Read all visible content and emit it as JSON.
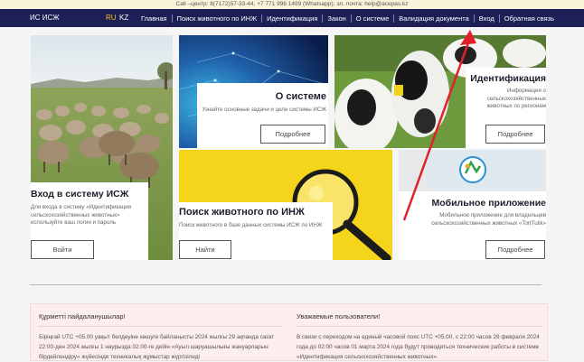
{
  "topbar": {
    "text": "Call –центр: 8(7172)57-33-44, +7 771 996 1499 (Whatsapp), эл. почта: help@acepas.kz"
  },
  "nav": {
    "brand": "ИС ИСЖ",
    "lang_ru": "RU",
    "lang_kz": "KZ",
    "items": [
      "Главная",
      "Поиск животного по ИНЖ",
      "Идентификация",
      "Закон",
      "О системе",
      "Валидация документа",
      "Вход",
      "Обратная связь"
    ]
  },
  "cards": {
    "login": {
      "title": "Вход в систему ИСЖ",
      "desc": "Для входа в систему «Идентификация сельскохозяйственных животных» используйте ваш логин и пароль",
      "button": "Войти"
    },
    "about": {
      "title": "О системе",
      "desc": "Узнайте основные задачи и цели системы ИСЖ",
      "button": "Подробнее"
    },
    "identification": {
      "title": "Идентификация",
      "desc": "Информация о сельскохозяйственных животных по регионам",
      "button": "Подробнее"
    },
    "search": {
      "title": "Поиск животного по ИНЖ",
      "desc": "Поиск животного в базе данных системы ИСЖ по ИНЖ",
      "button": "Найти"
    },
    "mobile": {
      "title": "Мобильное приложение",
      "desc": "Мобильное приложение для владельцев сельскохозяйственных животных «TortTulik»",
      "button": "Подробнее"
    }
  },
  "notice": {
    "kz_title": "Құрметті пайдаланушылар!",
    "kz_text": "Біріңғай UTC +05.00 уақыт белдеуіне көшуге байланысты 2024 жылғы 29 ақпанда сағат 22:00-ден 2024 жылғы 1 наурызда 02:00-ге дейін «Ауыл шаруашылығы жануарларын бірдейлендіру» жүйесінде техникалық жұмыстар жүргізіледі",
    "ru_title": "Уважаемые пользователи!",
    "ru_text": "В связи с переходом на единый часовой пояс UTC +05.00, с 22:00 часов 29 февраля 2024 года до 02:00 часов 01 марта 2024 года будут проводиться технические работы в системе «Идентификация сельскохозяйственных животных»."
  },
  "colors": {
    "nav_bg": "#1e1f57",
    "lang_active": "#f2c21b",
    "search_bg": "#f4d51c",
    "annotation_arrow": "#e0212b"
  }
}
